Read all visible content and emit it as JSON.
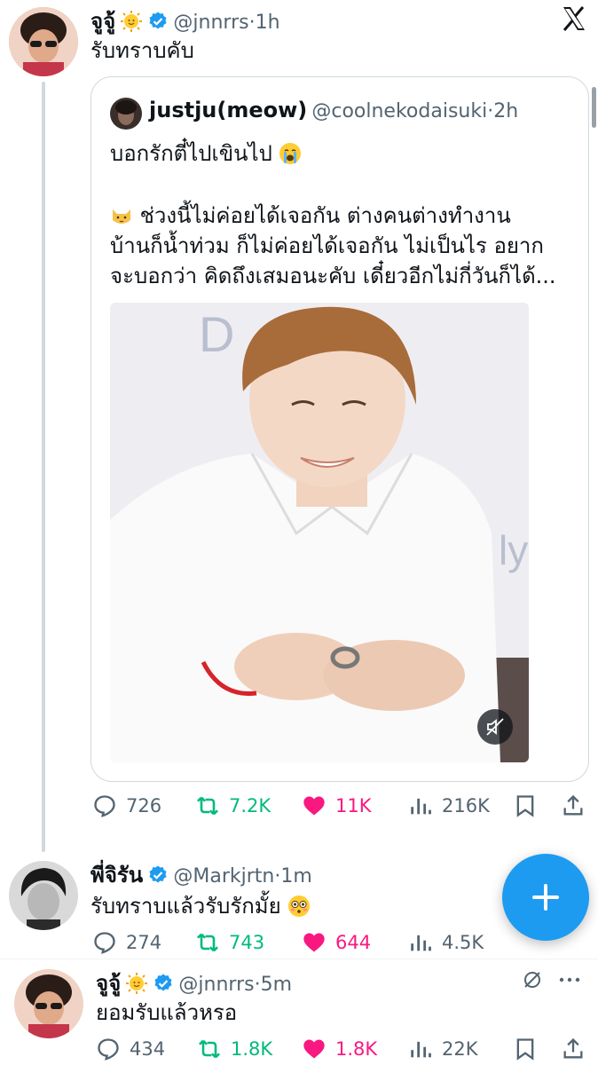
{
  "main_post": {
    "name": "จูจู้",
    "handle": "@jnnrrs",
    "time": "1h",
    "text": "รับทราบคับ"
  },
  "quoted_post": {
    "name": "justju(meow)",
    "handle": "@coolnekodaisuki",
    "time": "2h",
    "line1": "บอกรักตี๋ไปเขินไป",
    "body_line1": "ช่วงนี้ไม่ค่อยได้เจอกัน ต่างคนต่างทำงาน",
    "body_line2": "บ้านก็น้ำท่วม ก็ไม่ค่อยได้เจอกัน ไม่เป็นไร อยาก",
    "body_line3": "จะบอกว่า คิดถึงเสมอนะคับ เดี๋ยวอีกไม่กี่วันก็ได้..."
  },
  "main_actions": {
    "replies": "726",
    "reposts": "7.2K",
    "likes": "11K",
    "views": "216K"
  },
  "reply1": {
    "name": "พี่จิรัน",
    "handle": "@Markjrtn",
    "time": "1m",
    "text": "รับทราบแล้วรับรักมั้ย",
    "replies": "274",
    "reposts": "743",
    "likes": "644",
    "views": "4.5K"
  },
  "reply2": {
    "name": "จูจู้",
    "handle": "@jnnrrs",
    "time": "5m",
    "text": "ยอมรับแล้วหรอ",
    "replies": "434",
    "reposts": "1.8K",
    "likes": "1.8K",
    "views": "22K"
  },
  "separator": "·",
  "colors": {
    "accent": "#1d9bf0",
    "repost": "#00ba7c",
    "like": "#f91880",
    "muted": "#536471"
  }
}
